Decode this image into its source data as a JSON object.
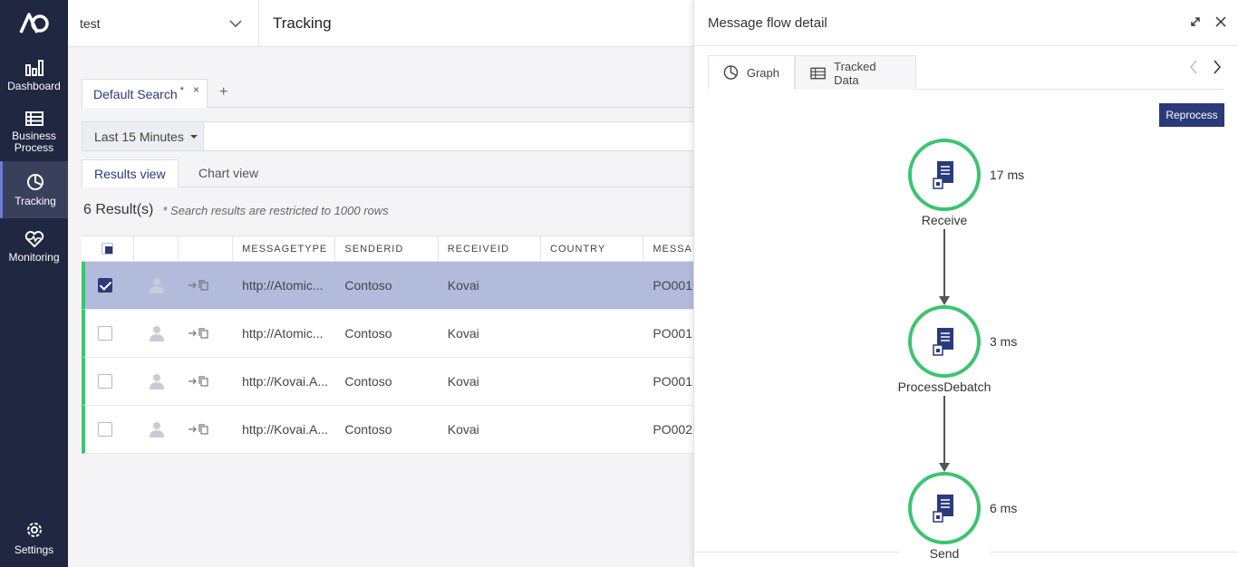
{
  "sidebar": {
    "items": [
      {
        "label": "Dashboard",
        "icon": "bar-chart-icon"
      },
      {
        "label": "Business Process",
        "icon": "list-icon"
      },
      {
        "label": "Tracking",
        "icon": "pie-clock-icon",
        "active": true
      },
      {
        "label": "Monitoring",
        "icon": "heart-pulse-icon"
      }
    ],
    "settings_label": "Settings"
  },
  "header": {
    "environment": "test",
    "title": "Tracking"
  },
  "search": {
    "tab_label": "Default Search",
    "tab_modified": "*",
    "close": "×",
    "add": "+",
    "time_range": "Last 15 Minutes"
  },
  "views": {
    "results": "Results view",
    "chart": "Chart view"
  },
  "results": {
    "count": "6 Result(s)",
    "note": "* Search results are restricted to 1000 rows"
  },
  "table": {
    "columns": [
      "MESSAGETYPE",
      "SENDERID",
      "RECEIVEID",
      "COUNTRY",
      "MESSA"
    ],
    "rows": [
      {
        "type": "http://Atomic...",
        "sender": "Contoso",
        "receiver": "Kovai",
        "country": "",
        "msg": "PO001",
        "checked": true
      },
      {
        "type": "http://Atomic...",
        "sender": "Contoso",
        "receiver": "Kovai",
        "country": "",
        "msg": "PO001",
        "checked": false
      },
      {
        "type": "http://Kovai.A...",
        "sender": "Contoso",
        "receiver": "Kovai",
        "country": "",
        "msg": "PO001",
        "checked": false
      },
      {
        "type": "http://Kovai.A...",
        "sender": "Contoso",
        "receiver": "Kovai",
        "country": "",
        "msg": "PO002",
        "checked": false
      }
    ]
  },
  "panel": {
    "title": "Message flow detail",
    "tabs": {
      "graph": "Graph",
      "tracked": "Tracked Data"
    },
    "reprocess": "Reprocess",
    "nodes": [
      {
        "label": "Receive",
        "time": "17 ms"
      },
      {
        "label": "ProcessDebatch",
        "time": "3 ms"
      },
      {
        "label": "Send",
        "time": "6 ms"
      }
    ]
  },
  "colors": {
    "sidebar": "#1f2741",
    "accent": "#2b3a7a",
    "success": "#3cc470",
    "selected_row": "#b3bbdc"
  }
}
